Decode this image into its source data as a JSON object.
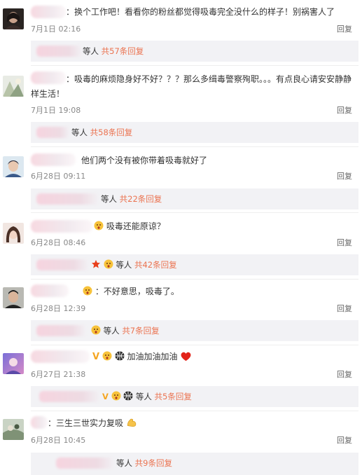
{
  "reply_label": "回复",
  "others_label": "等人",
  "comments": [
    {
      "text": "：换个工作吧！看看你的粉丝都觉得吸毒完全没什么的样子！别祸害人了",
      "time": "7月1日 02:16",
      "reply_count": "共57条回复"
    },
    {
      "text": "：吸毒的麻烦隐身好不好？？？那么多缉毒警察殉职。。。有点良心请安安静静",
      "text2": "样生活！",
      "time": "7月1日 19:08",
      "reply_count": "共58条回复"
    },
    {
      "text": "他们两个没有被你带着吸毒就好了",
      "time": "6月28日 09:11",
      "reply_count": "共22条回复"
    },
    {
      "text": "吸毒还能原谅？",
      "time": "6月28日 08:46",
      "reply_count": "共42条回复"
    },
    {
      "text": "：不好意思，吸毒了。",
      "time": "6月28日 12:39",
      "reply_count": "共7条回复"
    },
    {
      "text": "加油加油加油",
      "time": "6月27日 21:38",
      "reply_count": "共5条回复"
    },
    {
      "text": "：三生三世实力复吸",
      "time": "6月28日 10:45",
      "reply_count": "共9条回复"
    }
  ]
}
